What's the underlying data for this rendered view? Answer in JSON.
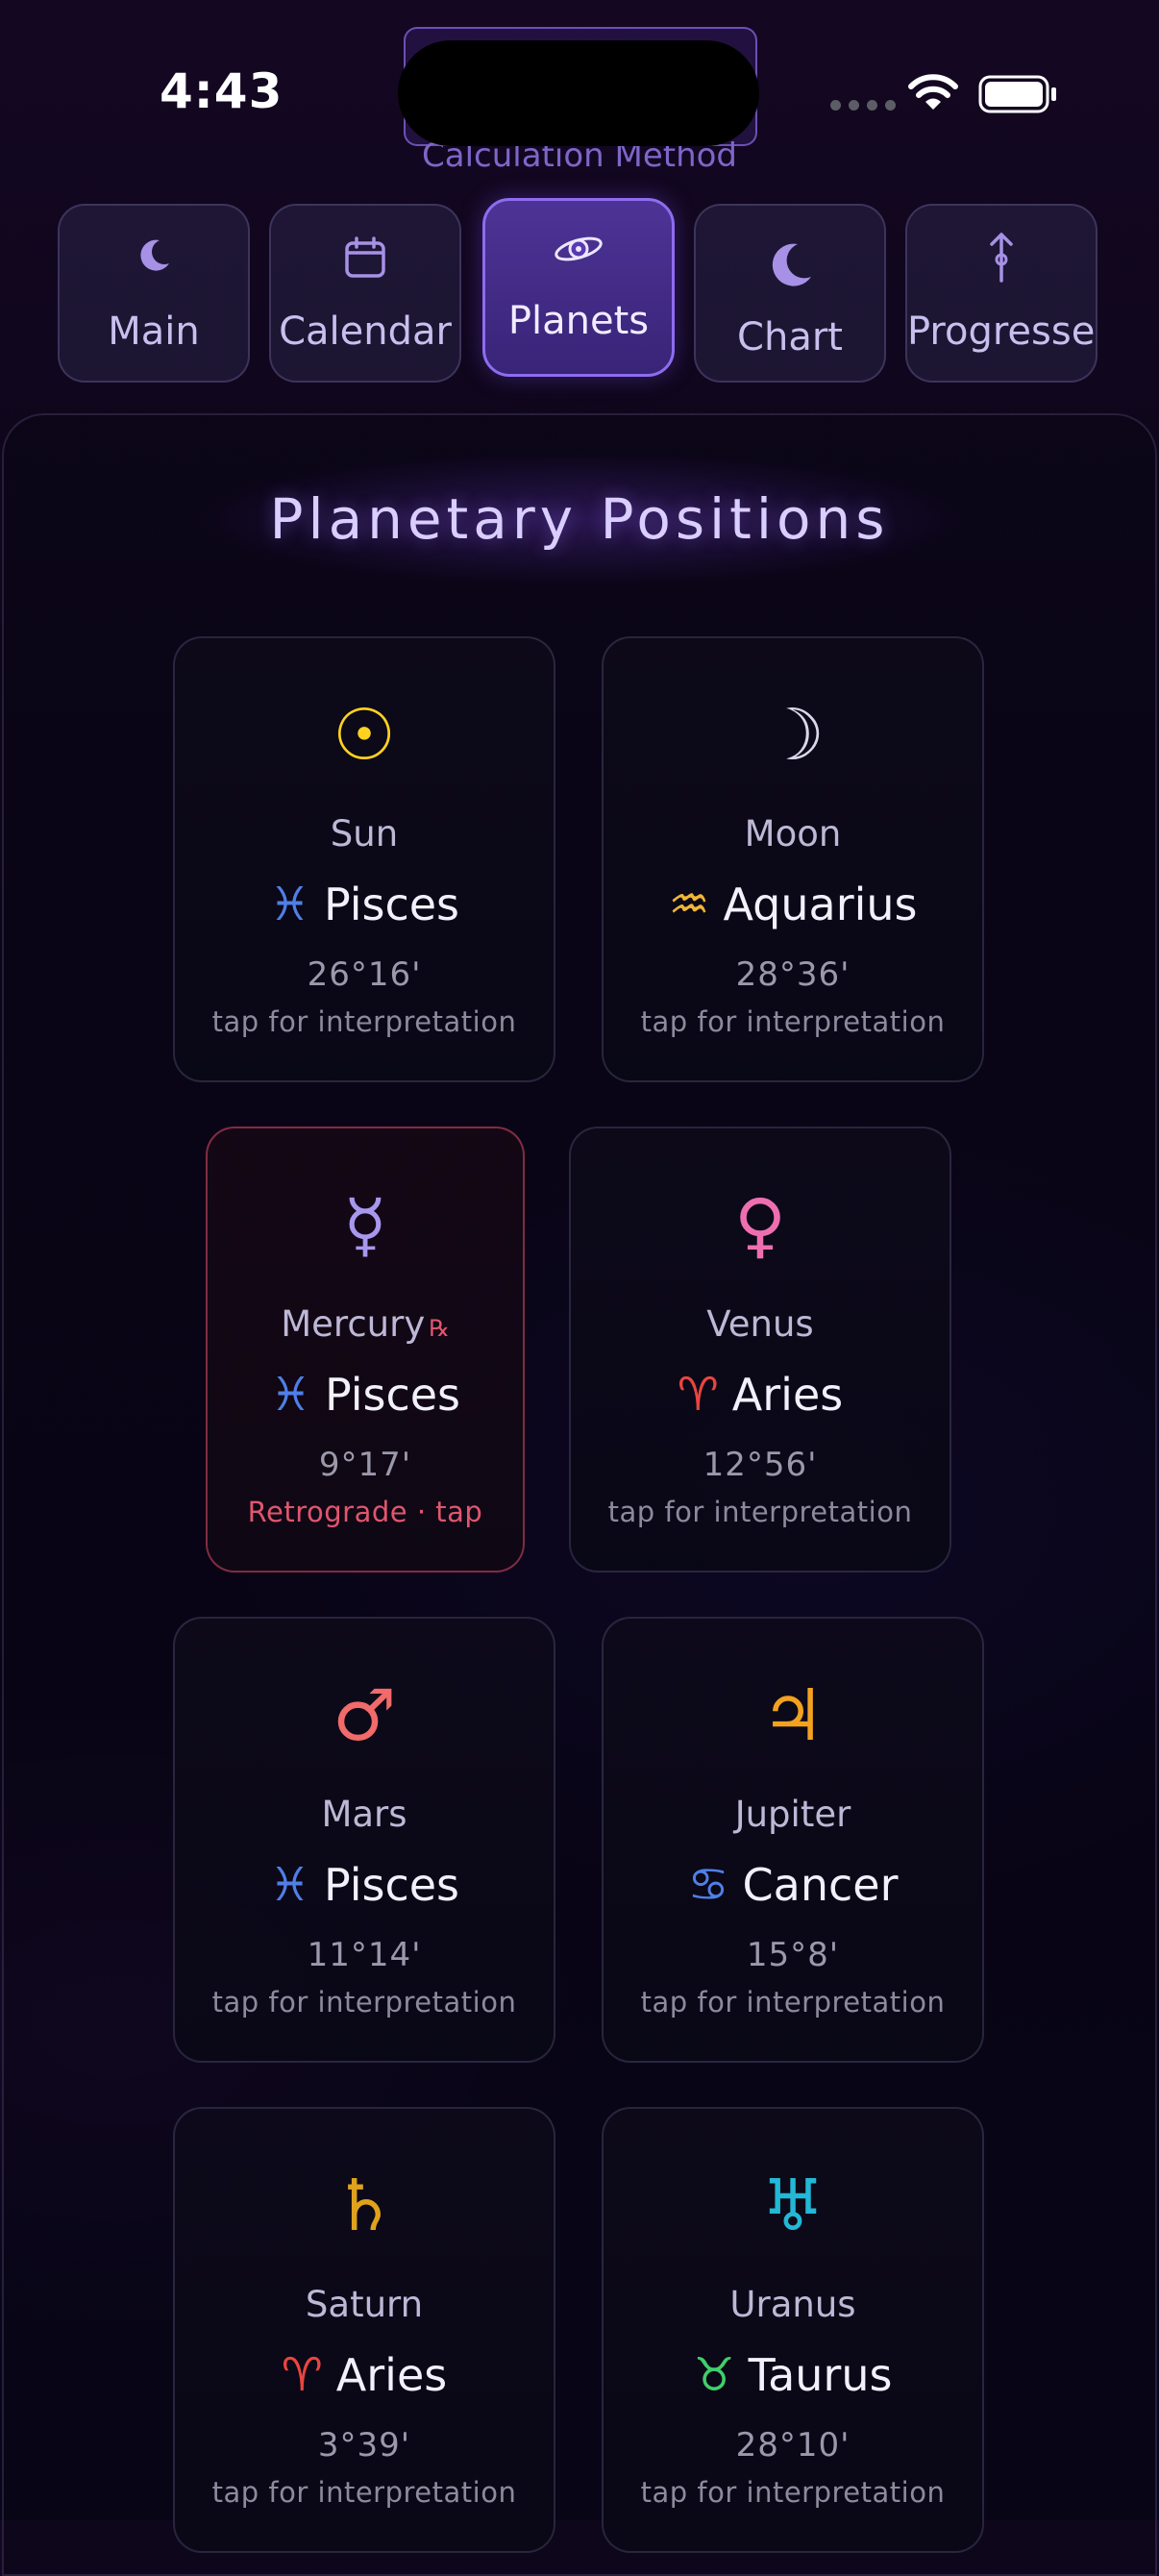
{
  "status_bar": {
    "time": "4:43"
  },
  "calc_method_label": "Calculation Method",
  "tabs": [
    {
      "label": "Main",
      "icon": "moon-icon",
      "active": false
    },
    {
      "label": "Calendar",
      "icon": "calendar-icon",
      "active": false
    },
    {
      "label": "Planets",
      "icon": "planet-icon",
      "active": true
    },
    {
      "label": "Chart",
      "icon": "moon-icon",
      "active": false
    },
    {
      "label": "Progressed",
      "icon": "progression-arrow-icon",
      "active": false
    }
  ],
  "title": "Planetary Positions",
  "planets": [
    {
      "glyph": "☉",
      "name": "Sun",
      "retrograde": false,
      "sign_glyph": "♓",
      "sign": "Pisces",
      "degree": "26°16'",
      "hint": "tap for interpretation",
      "planet_color": "#ffd21f",
      "sign_color": "#4f7fe8"
    },
    {
      "glyph": "☽",
      "name": "Moon",
      "retrograde": false,
      "sign_glyph": "♒",
      "sign": "Aquarius",
      "degree": "28°36'",
      "hint": "tap for interpretation",
      "planet_color": "#d8d8e8",
      "sign_color": "#f2b636"
    },
    {
      "glyph": "☿",
      "name": "Mercury",
      "retrograde": true,
      "retro_mark": "℞",
      "sign_glyph": "♓",
      "sign": "Pisces",
      "degree": "9°17'",
      "hint": "Retrograde · tap",
      "planet_color": "#a897ee",
      "sign_color": "#4f7fe8"
    },
    {
      "glyph": "♀",
      "name": "Venus",
      "retrograde": false,
      "sign_glyph": "♈",
      "sign": "Aries",
      "degree": "12°56'",
      "hint": "tap for interpretation",
      "planet_color": "#ee6fb0",
      "sign_color": "#e8463f"
    },
    {
      "glyph": "♂",
      "name": "Mars",
      "retrograde": false,
      "sign_glyph": "♓",
      "sign": "Pisces",
      "degree": "11°14'",
      "hint": "tap for interpretation",
      "planet_color": "#f26a6a",
      "sign_color": "#4f7fe8"
    },
    {
      "glyph": "♃",
      "name": "Jupiter",
      "retrograde": false,
      "sign_glyph": "♋",
      "sign": "Cancer",
      "degree": "15°8'",
      "hint": "tap for interpretation",
      "planet_color": "#f2a21f",
      "sign_color": "#4f7fe8"
    },
    {
      "glyph": "♄",
      "name": "Saturn",
      "retrograde": false,
      "sign_glyph": "♈",
      "sign": "Aries",
      "degree": "3°39'",
      "hint": "tap for interpretation",
      "planet_color": "#e0a11c",
      "sign_color": "#e8463f"
    },
    {
      "glyph": "♅",
      "name": "Uranus",
      "retrograde": false,
      "sign_glyph": "♉",
      "sign": "Taurus",
      "degree": "28°10'",
      "hint": "tap for interpretation",
      "planet_color": "#22b8d6",
      "sign_color": "#3fcf6a"
    }
  ]
}
